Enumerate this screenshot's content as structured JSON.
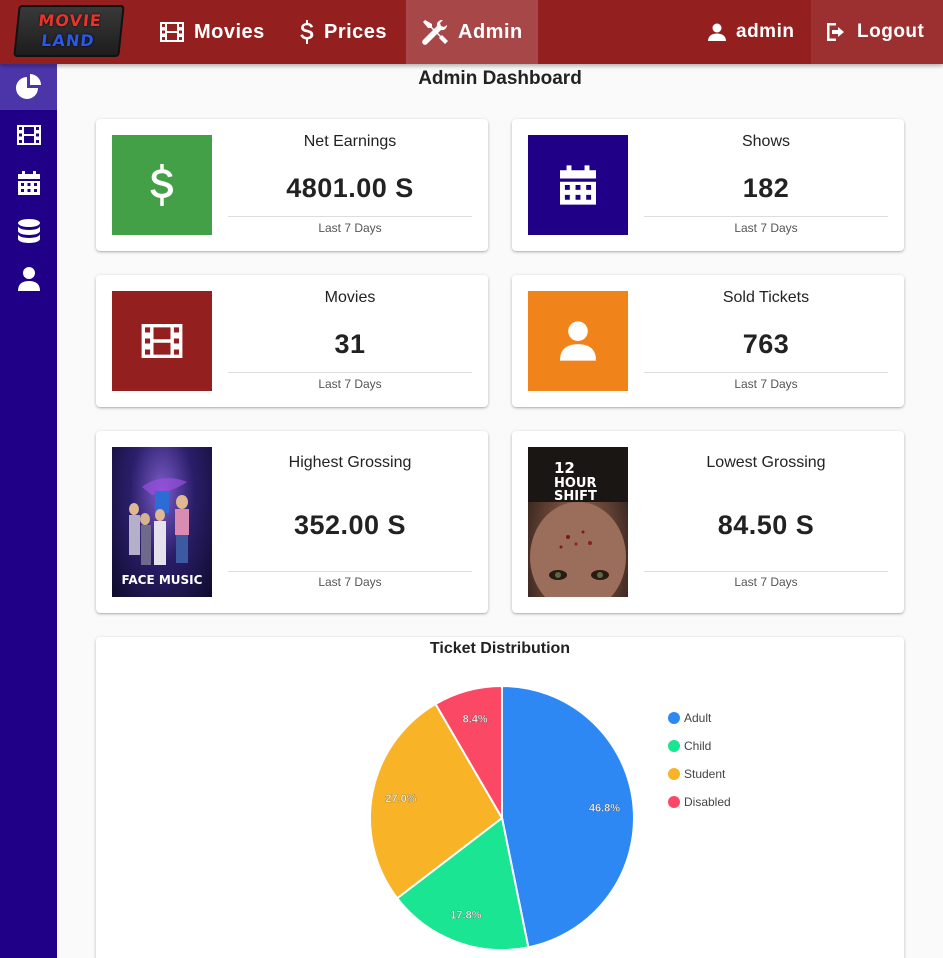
{
  "navbar": {
    "logo_line1": "MOVIE",
    "logo_line2": "LAND",
    "movies": "Movies",
    "prices": "Prices",
    "admin": "Admin",
    "user": "admin",
    "logout": "Logout",
    "color": "#941f1f"
  },
  "sidebar": {
    "color": "#1f0087",
    "items": [
      "pie-chart-icon",
      "film-icon",
      "calendar-icon",
      "database-icon",
      "user-icon"
    ]
  },
  "page_title": "Admin Dashboard",
  "cards": {
    "net_earnings": {
      "title": "Net Earnings",
      "value": "4801.00 S",
      "foot": "Last 7 Days",
      "color": "#43a047"
    },
    "shows": {
      "title": "Shows",
      "value": "182",
      "foot": "Last 7 Days",
      "color": "#1f0087"
    },
    "movies": {
      "title": "Movies",
      "value": "31",
      "foot": "Last 7 Days",
      "color": "#941f1f"
    },
    "sold_tickets": {
      "title": "Sold Tickets",
      "value": "763",
      "foot": "Last 7 Days",
      "color": "#f0841b"
    },
    "highest": {
      "title": "Highest Grossing",
      "value": "352.00 S",
      "foot": "Last 7 Days",
      "poster_text": "FACE MUSIC"
    },
    "lowest": {
      "title": "Lowest Grossing",
      "value": "84.50 S",
      "foot": "Last 7 Days",
      "poster_text_1": "12",
      "poster_text_2": "HOUR",
      "poster_text_3": "SHIFT"
    }
  },
  "chart_data": {
    "type": "pie",
    "title": "Ticket Distribution",
    "categories": [
      "Adult",
      "Child",
      "Student",
      "Disabled"
    ],
    "values": [
      46.8,
      17.8,
      27.0,
      8.4
    ],
    "labels": [
      "46.8%",
      "17.8%",
      "27.0%",
      "8.4%"
    ],
    "colors": [
      "#2e88f3",
      "#19e592",
      "#f9b327",
      "#fb4865"
    ],
    "legend_position": "right"
  }
}
